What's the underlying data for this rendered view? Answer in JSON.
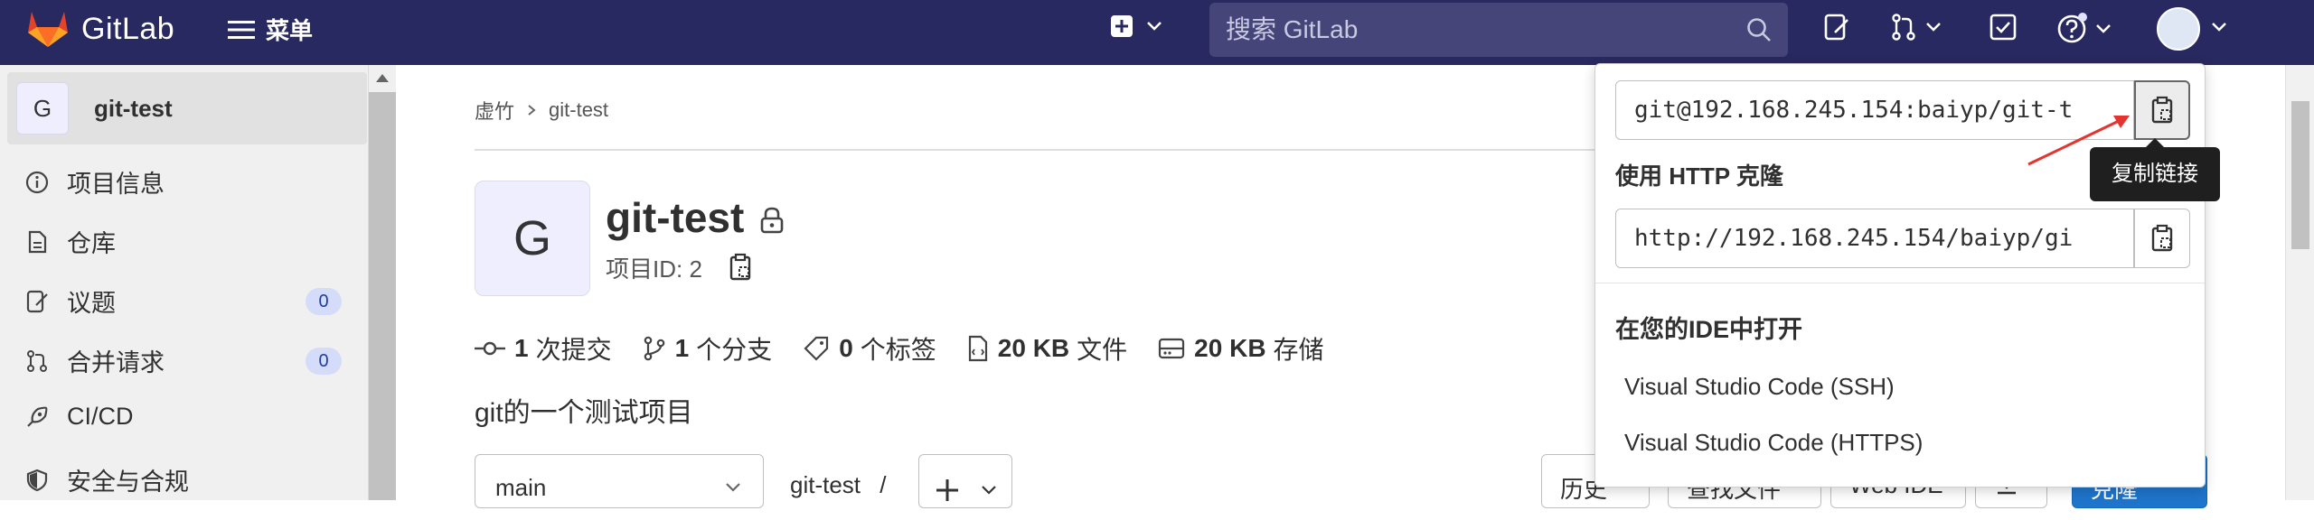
{
  "topbar": {
    "app_name": "GitLab",
    "menu_label": "菜单",
    "search_placeholder": "搜索 GitLab",
    "icons": [
      "plus-square-icon",
      "chevron-down-icon",
      "search-icon",
      "issues-icon",
      "merge-request-icon",
      "todo-icon",
      "help-icon",
      "avatar"
    ]
  },
  "sidebar": {
    "project_initial": "G",
    "project_name": "git-test",
    "items": [
      {
        "label": "项目信息",
        "icon": "info-icon"
      },
      {
        "label": "仓库",
        "icon": "repository-icon"
      },
      {
        "label": "议题",
        "icon": "issues-icon",
        "badge": "0"
      },
      {
        "label": "合并请求",
        "icon": "merge-request-icon",
        "badge": "0"
      },
      {
        "label": "CI/CD",
        "icon": "rocket-icon"
      },
      {
        "label": "安全与合规",
        "icon": "shield-icon"
      }
    ]
  },
  "breadcrumb": {
    "group": "虚竹",
    "project": "git-test"
  },
  "project": {
    "initial": "G",
    "title": "git-test",
    "id_label": "项目ID: 2",
    "description": "git的一个测试项目",
    "stats": [
      {
        "value": "1",
        "label": "次提交",
        "icon": "commit-icon"
      },
      {
        "value": "1",
        "label": "个分支",
        "icon": "branch-icon"
      },
      {
        "value": "0",
        "label": "个标签",
        "icon": "tag-icon"
      },
      {
        "value": "20 KB",
        "label": "文件",
        "icon": "file-icon"
      },
      {
        "value": "20 KB",
        "label": "存储",
        "icon": "storage-icon"
      }
    ]
  },
  "repo_bar": {
    "branch": "main",
    "path": "git-test",
    "path_sep": "/",
    "buttons": [
      "历史",
      "查找文件",
      "Web IDE",
      "克隆"
    ]
  },
  "clone_dropdown": {
    "ssh_url": "git@192.168.245.154:baiyp/git-t",
    "http_label": "使用 HTTP 克隆",
    "http_url": "http://192.168.245.154/baiyp/gi",
    "ide_label": "在您的IDE中打开",
    "ide_options": [
      "Visual Studio Code (SSH)",
      "Visual Studio Code (HTTPS)"
    ],
    "tooltip": "复制链接"
  },
  "colors": {
    "topbar": "#292961",
    "accent": "#1f75cb",
    "badge_bg": "#d4dcfa",
    "annotation_arrow": "#e3342f"
  }
}
